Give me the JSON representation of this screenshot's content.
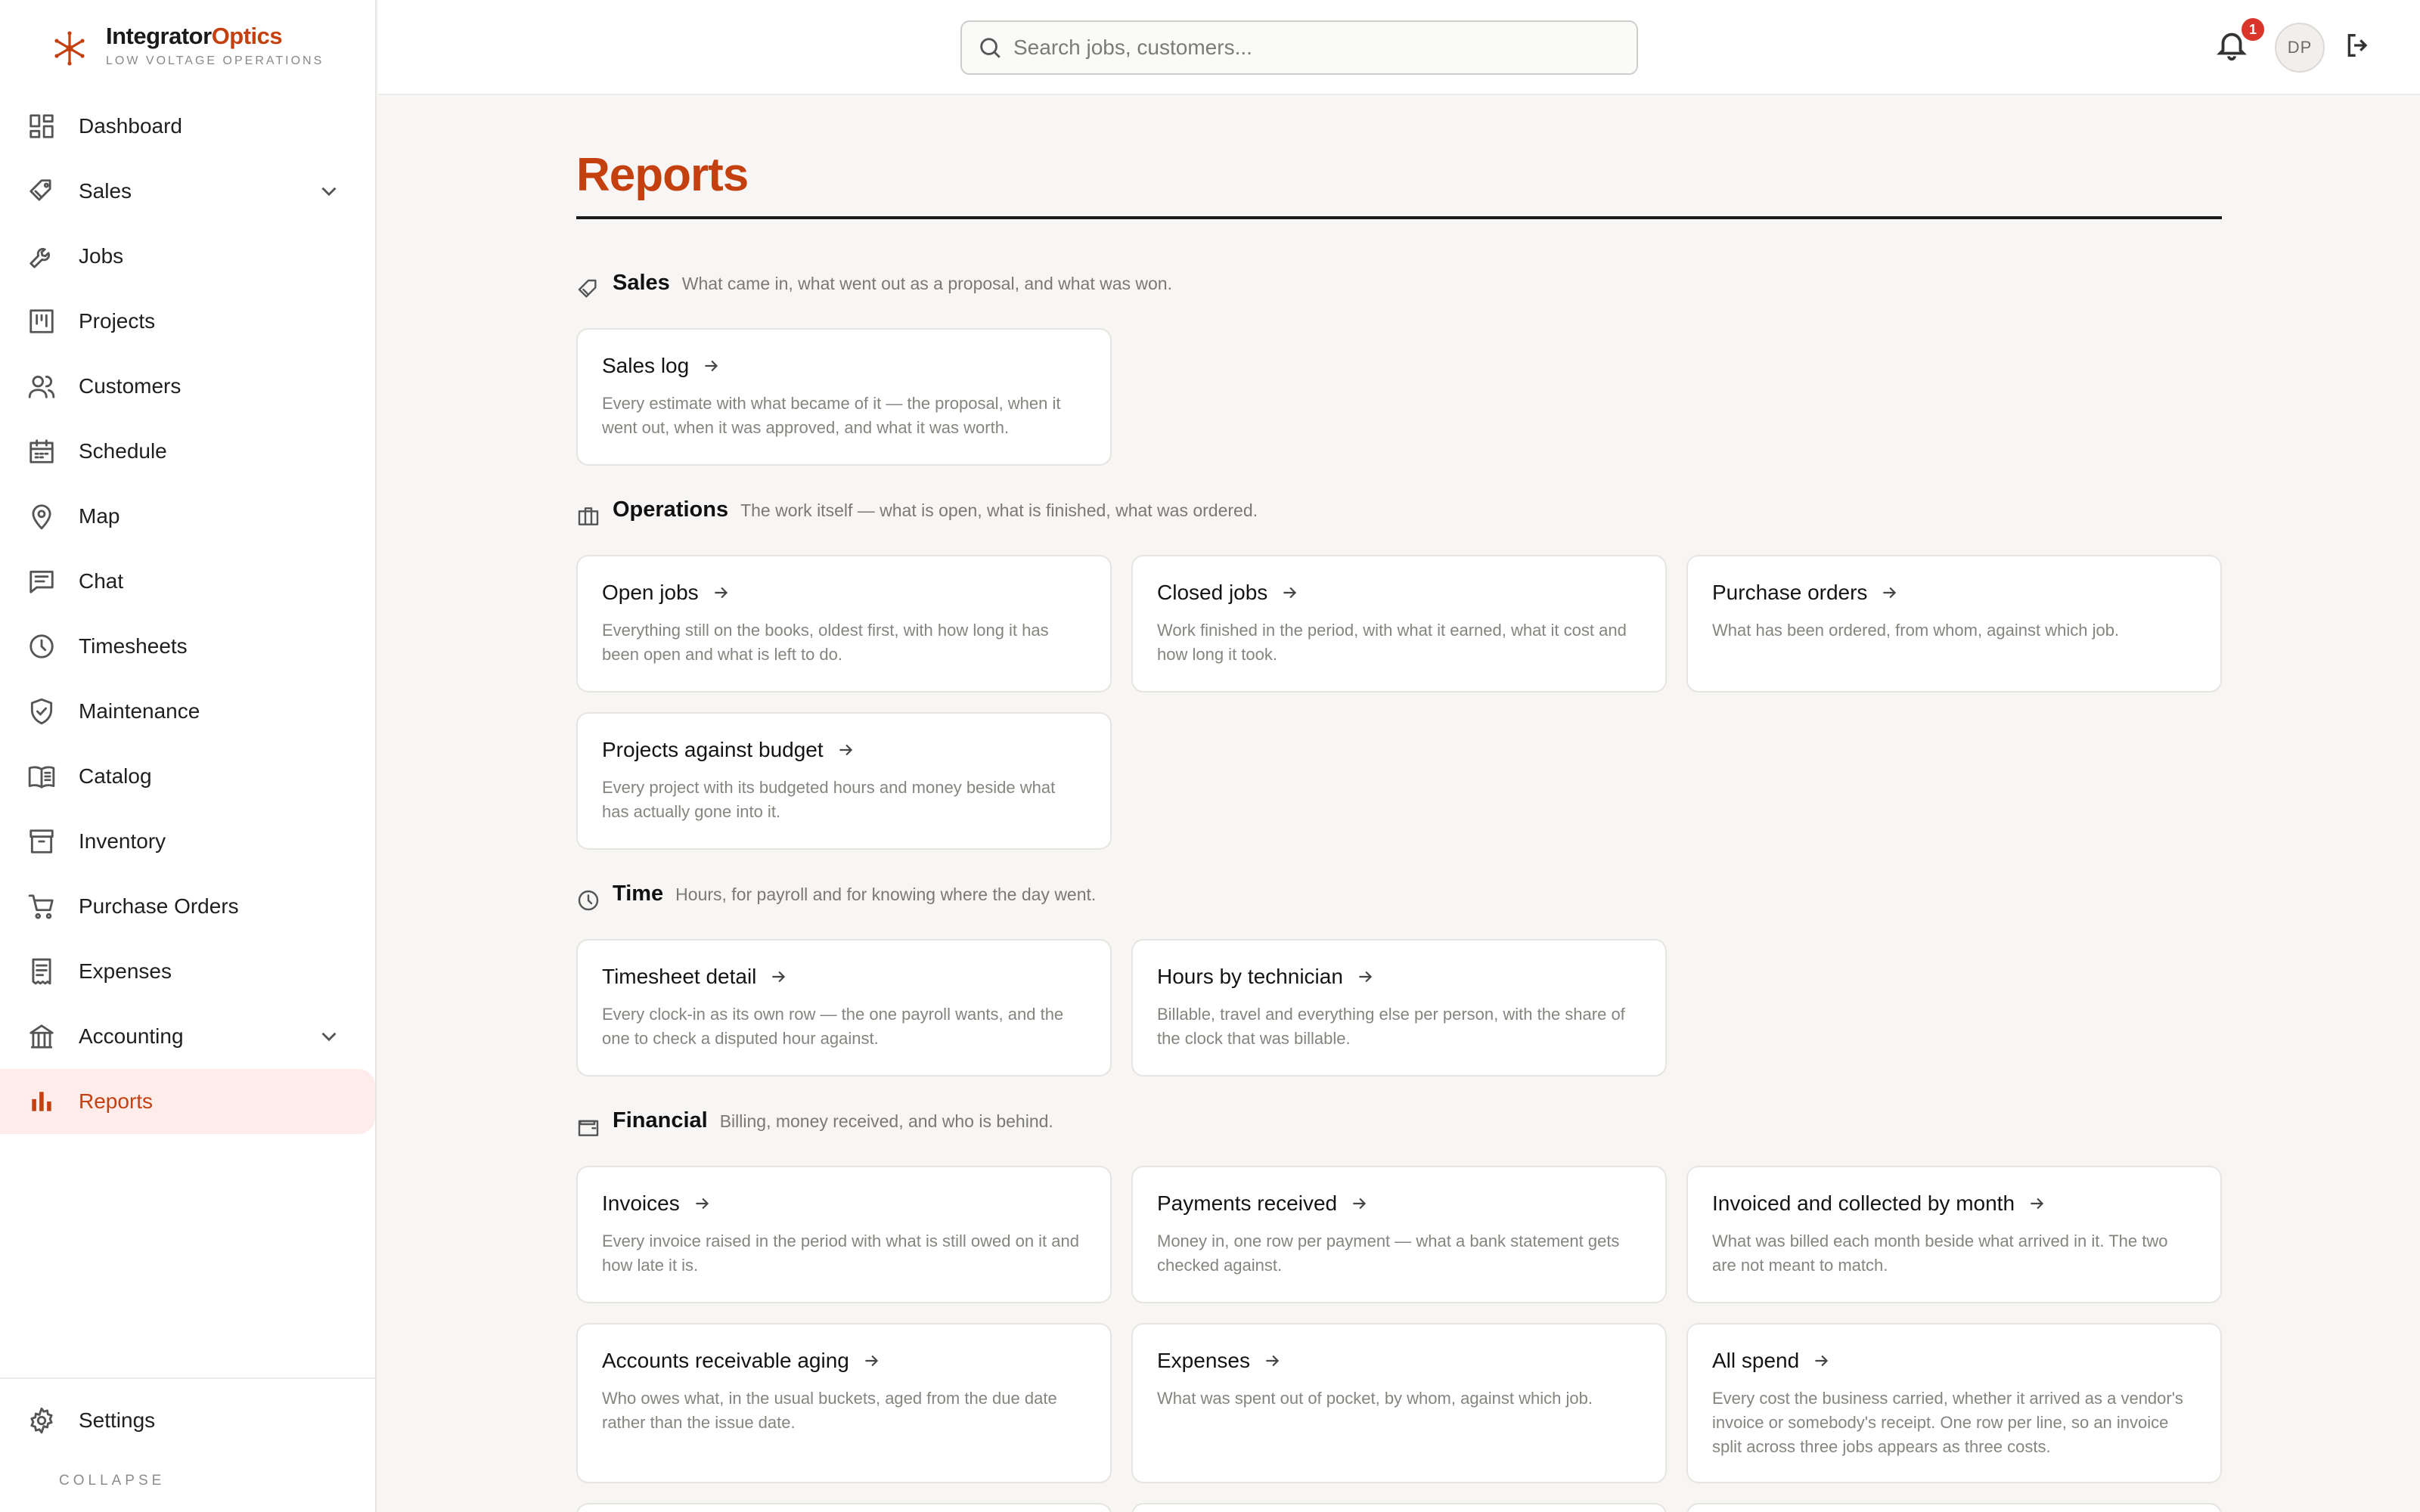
{
  "brand": {
    "name_main": "Integrator",
    "name_accent": "Optics",
    "subtitle": "LOW VOLTAGE OPERATIONS",
    "accent_color": "#c4400f"
  },
  "nav": {
    "items": [
      {
        "label": "Dashboard",
        "icon": "dashboard-icon"
      },
      {
        "label": "Sales",
        "icon": "tag-icon",
        "expandable": true
      },
      {
        "label": "Jobs",
        "icon": "wrench-icon"
      },
      {
        "label": "Projects",
        "icon": "kanban-icon"
      },
      {
        "label": "Customers",
        "icon": "users-icon"
      },
      {
        "label": "Schedule",
        "icon": "calendar-icon"
      },
      {
        "label": "Map",
        "icon": "map-pin-icon"
      },
      {
        "label": "Chat",
        "icon": "chat-icon"
      },
      {
        "label": "Timesheets",
        "icon": "clock-icon"
      },
      {
        "label": "Maintenance",
        "icon": "shield-check-icon"
      },
      {
        "label": "Catalog",
        "icon": "book-icon"
      },
      {
        "label": "Inventory",
        "icon": "archive-icon"
      },
      {
        "label": "Purchase Orders",
        "icon": "cart-icon"
      },
      {
        "label": "Expenses",
        "icon": "receipt-icon"
      },
      {
        "label": "Accounting",
        "icon": "bank-icon",
        "expandable": true
      },
      {
        "label": "Reports",
        "icon": "bar-chart-icon",
        "active": true
      }
    ],
    "settings_label": "Settings",
    "collapse_label": "COLLAPSE"
  },
  "topbar": {
    "search_placeholder": "Search jobs, customers...",
    "notification_count": "1",
    "avatar_initials": "DP"
  },
  "page": {
    "title": "Reports"
  },
  "sections": {
    "sales": {
      "title": "Sales",
      "desc": "What came in, what went out as a proposal, and what was won.",
      "cards": [
        {
          "title": "Sales log",
          "desc": "Every estimate with what became of it — the proposal, when it went out, when it was approved, and what it was worth."
        }
      ]
    },
    "operations": {
      "title": "Operations",
      "desc": "The work itself — what is open, what is finished, what was ordered.",
      "cards": [
        {
          "title": "Open jobs",
          "desc": "Everything still on the books, oldest first, with how long it has been open and what is left to do."
        },
        {
          "title": "Closed jobs",
          "desc": "Work finished in the period, with what it earned, what it cost and how long it took."
        },
        {
          "title": "Purchase orders",
          "desc": "What has been ordered, from whom, against which job."
        },
        {
          "title": "Projects against budget",
          "desc": "Every project with its budgeted hours and money beside what has actually gone into it."
        }
      ]
    },
    "time": {
      "title": "Time",
      "desc": "Hours, for payroll and for knowing where the day went.",
      "cards": [
        {
          "title": "Timesheet detail",
          "desc": "Every clock-in as its own row — the one payroll wants, and the one to check a disputed hour against."
        },
        {
          "title": "Hours by technician",
          "desc": "Billable, travel and everything else per person, with the share of the clock that was billable."
        }
      ]
    },
    "financial": {
      "title": "Financial",
      "desc": "Billing, money received, and who is behind.",
      "cards": [
        {
          "title": "Invoices",
          "desc": "Every invoice raised in the period with what is still owed on it and how late it is."
        },
        {
          "title": "Payments received",
          "desc": "Money in, one row per payment — what a bank statement gets checked against."
        },
        {
          "title": "Invoiced and collected by month",
          "desc": "What was billed each month beside what arrived in it. The two are not meant to match."
        },
        {
          "title": "Accounts receivable aging",
          "desc": "Who owes what, in the usual buckets, aged from the due date rather than the issue date."
        },
        {
          "title": "Expenses",
          "desc": "What was spent out of pocket, by whom, against which job."
        },
        {
          "title": "All spend",
          "desc": "Every cost the business carried, whether it arrived as a vendor's invoice or somebody's receipt. One row per line, so an invoice split across three jobs appears as three costs."
        }
      ]
    }
  }
}
